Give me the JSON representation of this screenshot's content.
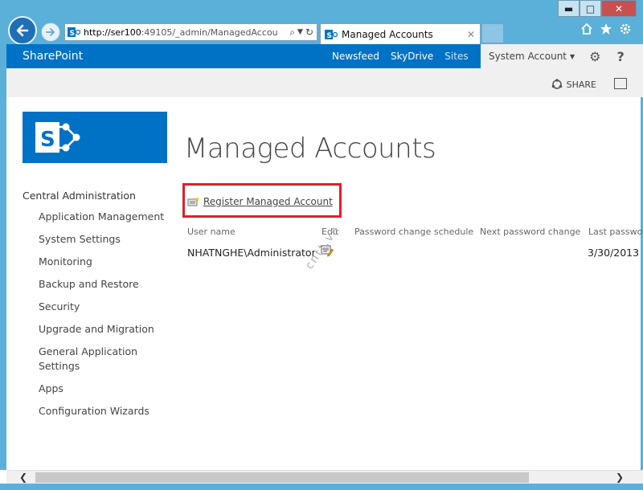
{
  "browser": {
    "url_host": "http://ser100",
    "url_rest": ":49105/_admin/ManagedAccou",
    "tab_title": "Managed Accounts",
    "window_buttons": {
      "minimize": "▬",
      "maximize": "□",
      "close": "✕"
    }
  },
  "suitebar": {
    "brand": "SharePoint",
    "nav": [
      "Newsfeed",
      "SkyDrive",
      "Sites"
    ],
    "user": "System Account"
  },
  "ribbon": {
    "share_label": "SHARE"
  },
  "page": {
    "title": "Managed Accounts"
  },
  "leftnav": {
    "header": "Central Administration",
    "items": [
      "Application Management",
      "System Settings",
      "Monitoring",
      "Backup and Restore",
      "Security",
      "Upgrade and Migration",
      "General Application Settings",
      "Apps",
      "Configuration Wizards"
    ]
  },
  "actions": {
    "register_label": "Register Managed Account"
  },
  "table": {
    "columns": [
      "User name",
      "Edit",
      "Password change schedule",
      "Next password change",
      "Last passwo"
    ],
    "rows": [
      {
        "user": "NHATNGHE\\Administrator",
        "last": "3/30/2013"
      }
    ]
  },
  "watermark": "cntt.vn",
  "colors": {
    "suite_blue": "#0072c6",
    "ie_frame": "#5ab0d8",
    "highlight_red": "#e0202a"
  }
}
